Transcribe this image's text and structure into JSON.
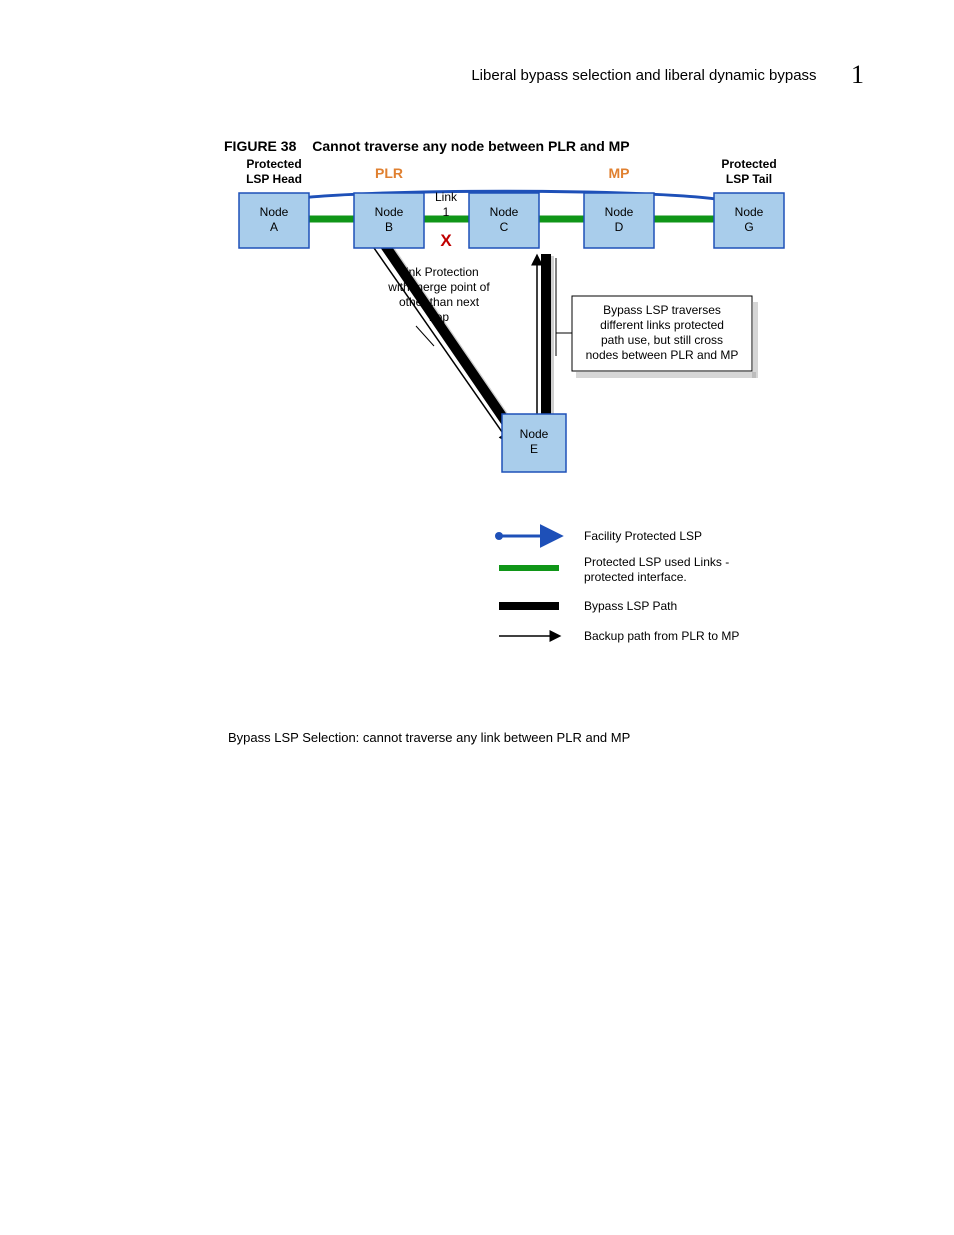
{
  "header": {
    "title": "Liberal bypass selection and liberal dynamic bypass",
    "page_num": "1"
  },
  "figure": {
    "label": "FIGURE 38",
    "title": "Cannot traverse any node between PLR and MP"
  },
  "diagram": {
    "head_label_1": "Protected",
    "head_label_2": "LSP Head",
    "plr": "PLR",
    "mp": "MP",
    "tail_label_1": "Protected",
    "tail_label_2": "LSP Tail",
    "link_label_1": "Link",
    "link_label_2": "1",
    "x_mark": "X",
    "note_left_1": "Link Protection",
    "note_left_2": "with merge point of",
    "note_left_3": "other than next",
    "note_left_4": "hop",
    "note_right_1": "Bypass LSP traverses",
    "note_right_2": "different links protected",
    "note_right_3": "path use, but still cross",
    "note_right_4": "nodes between PLR and MP",
    "nodes": {
      "A1": "Node",
      "A2": "A",
      "B1": "Node",
      "B2": "B",
      "C1": "Node",
      "C2": "C",
      "D1": "Node",
      "D2": "D",
      "G1": "Node",
      "G2": "G",
      "E1": "Node",
      "E2": "E"
    },
    "legend": {
      "l1": "Facility Protected LSP",
      "l2a": "Protected LSP used Links -",
      "l2b": "protected interface.",
      "l3": "Bypass LSP Path",
      "l4": "Backup path from PLR to MP"
    }
  },
  "body": "Bypass LSP Selection: cannot traverse any link between PLR and MP"
}
